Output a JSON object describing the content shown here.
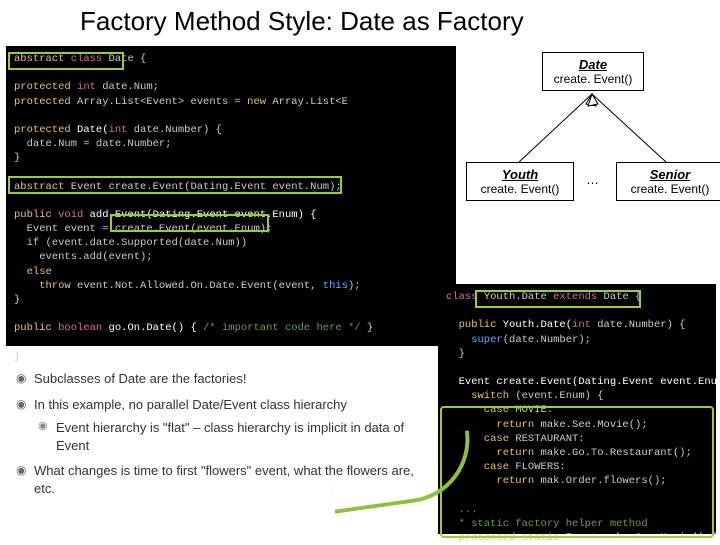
{
  "title": "Factory Method Style: Date as Factory",
  "diagram": {
    "date": {
      "name": "Date",
      "method": "create. Event()"
    },
    "youth": {
      "name": "Youth",
      "method": "create. Event()"
    },
    "senior": {
      "name": "Senior",
      "method": "create. Event()"
    },
    "dots": "…"
  },
  "code_left": {
    "l1a": "abstract",
    "l1b": " class",
    "l1c": " Date {",
    "l2a": "protected",
    "l2b": " int",
    "l2c": " date.Num;",
    "l3a": "protected",
    "l3b": " Array.List<Event> events = ",
    "l3c": "new",
    "l3d": " Array.List<E",
    "l4a": "protected",
    "l4b": " Date(",
    "l4c": "int",
    "l4d": " date.Number) {",
    "l5": "  date.Num = date.Number;",
    "l6": "}",
    "l7a": "abstract",
    "l7b": " Event create.Event(Dating.Event event.Num);",
    "l8a": "public",
    "l8b": " void",
    "l8c": " add.Event(Dating.Event event.Enum) {",
    "l9": "  Event event = create.Event(event.Enum);",
    "l10a": "  if",
    "l10b": " (event.date.Supported(date.Num))",
    "l11": "    events.add(event);",
    "l12": "  else",
    "l13a": "    throw",
    "l13b": " event.Not.Allowed.On.Date.Event(event, ",
    "l13c": "this",
    "l13d": ");",
    "l14": "}",
    "l15a": "public",
    "l15b": " boolean",
    "l15c": " go.On.Date() { ",
    "l15d": "/* important code here */",
    "l15e": " }",
    "l16": "}"
  },
  "code_right": {
    "l1a": "class",
    "l1b": " Youth.Date ",
    "l1c": "extends",
    "l1d": " Date {",
    "l2a": "  public",
    "l2b": " Youth.Date(",
    "l2c": "int",
    "l2d": " date.Number) {",
    "l3a": "    super",
    "l3b": "(date.Number);",
    "l4": "  }",
    "l5": "  Event create.Event(Dating.Event event.Enum) {",
    "l6a": "    switch",
    "l6b": " (event.Enum) {",
    "l7a": "      case",
    "l7b": " MOVIE:",
    "l8a": "        return",
    "l8b": " make.See.Movie();",
    "l9a": "      case",
    "l9b": " RESTAURANT:",
    "l10a": "        return",
    "l10b": " make.Go.To.Restaurant();",
    "l11a": "      case",
    "l11b": " FLOWERS:",
    "l12a": "        return",
    "l12b": " mak.Order.flowers();",
    "l13": "  ...",
    "l14": "  * static factory helper method",
    "l15a": "  protected",
    "l15b": " static ",
    "l15c": "Event make.See.Movie() { ret"
  },
  "bullets": {
    "b1": "Subclasses of Date are the factories!",
    "b2": "In this example, no parallel Date/Event class hierarchy",
    "b2a": "Event hierarchy is \"flat\" – class hierarchy is implicit in data of Event",
    "b3": "What changes is time to first \"flowers\" event, what the flowers are, etc."
  }
}
